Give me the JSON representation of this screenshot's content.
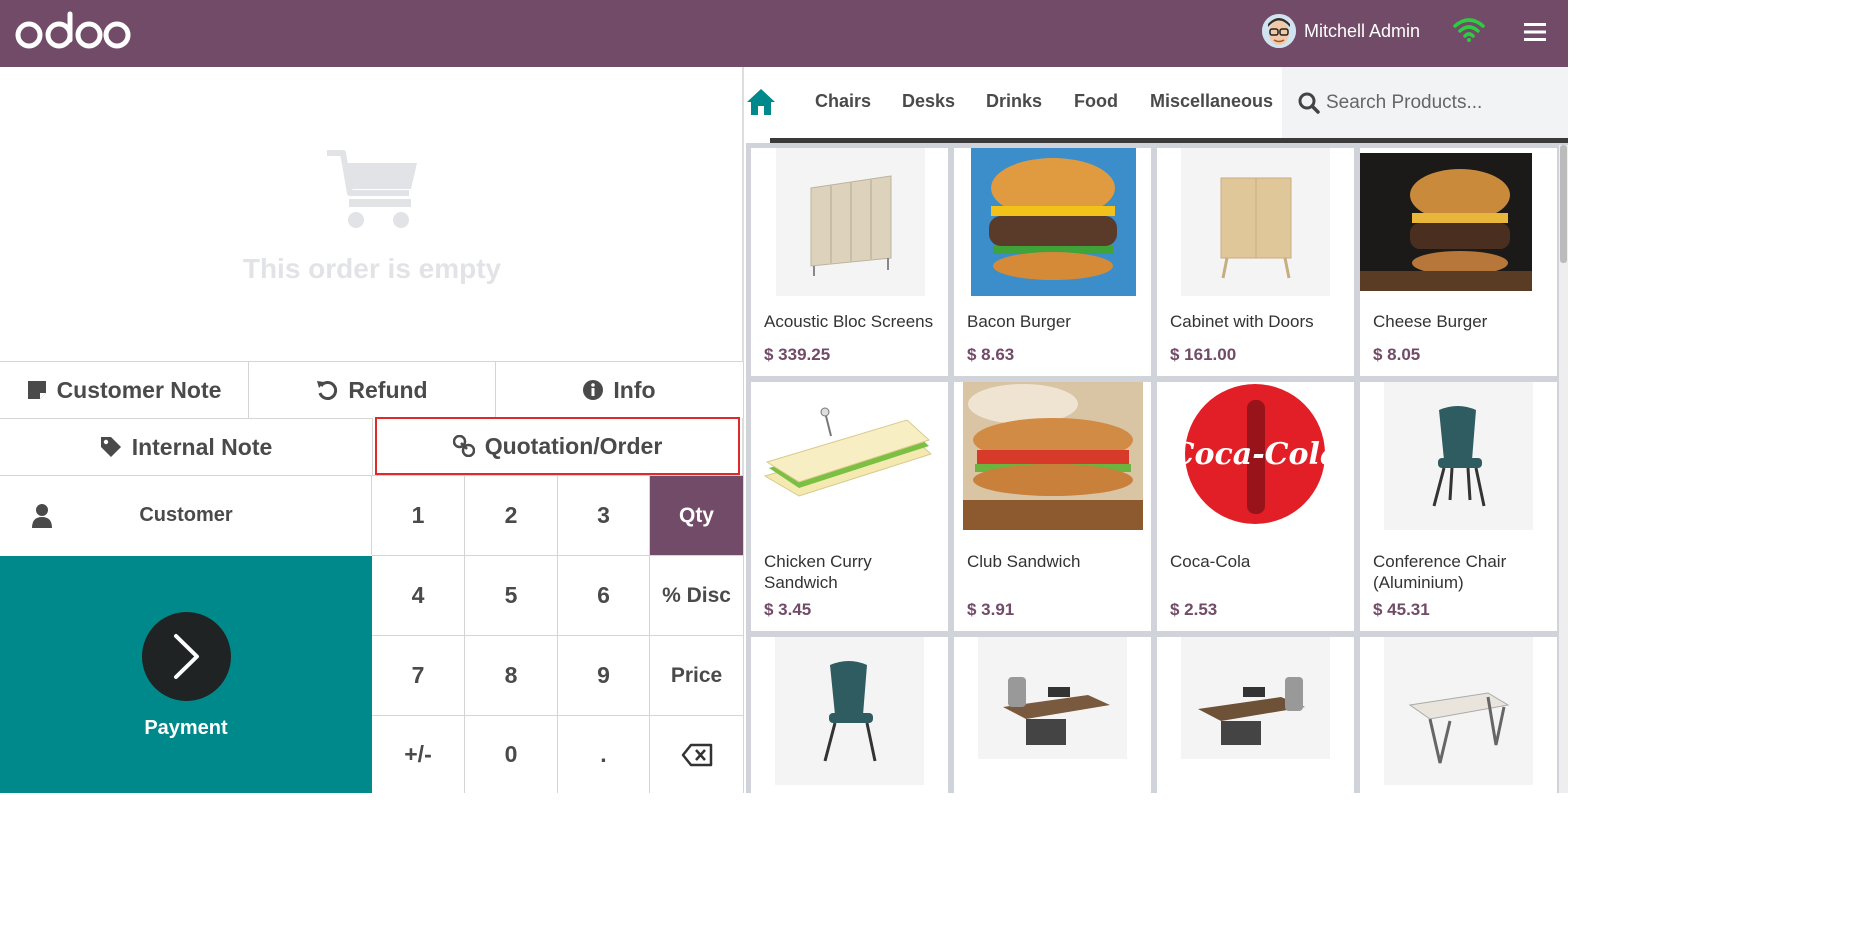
{
  "app": {
    "logo_text": "odoo",
    "user_name": "Mitchell Admin",
    "brand_color": "#714B67",
    "accent_color": "#00898A"
  },
  "order": {
    "empty_message": "This order is empty"
  },
  "controls": {
    "customer_note": "Customer Note",
    "refund": "Refund",
    "info": "Info",
    "internal_note": "Internal Note",
    "quotation_order": "Quotation/Order",
    "customer": "Customer",
    "payment": "Payment"
  },
  "numpad": {
    "keys": [
      "1",
      "2",
      "3",
      "Qty",
      "4",
      "5",
      "6",
      "% Disc",
      "7",
      "8",
      "9",
      "Price",
      "+/-",
      "0",
      "."
    ],
    "backspace_icon": "backspace-icon",
    "active_mode": "Qty"
  },
  "categories": {
    "items": [
      "Chairs",
      "Desks",
      "Drinks",
      "Food",
      "Miscellaneous"
    ]
  },
  "search": {
    "placeholder": "Search Products..."
  },
  "products": [
    {
      "name": "Acoustic Bloc Screens",
      "price": "$ 339.25"
    },
    {
      "name": "Bacon Burger",
      "price": "$ 8.63"
    },
    {
      "name": "Cabinet with Doors",
      "price": "$ 161.00"
    },
    {
      "name": "Cheese Burger",
      "price": "$ 8.05"
    },
    {
      "name": "Chicken Curry Sandwich",
      "price": "$ 3.45"
    },
    {
      "name": "Club Sandwich",
      "price": "$ 3.91"
    },
    {
      "name": "Coca-Cola",
      "price": "$ 2.53"
    },
    {
      "name": "Conference Chair (Aluminium)",
      "price": "$ 45.31"
    }
  ],
  "coca_cola_logo_text": "Coca-Cola"
}
